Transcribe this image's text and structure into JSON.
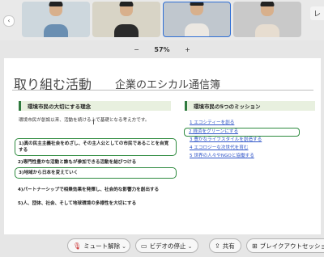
{
  "video_strip": {
    "more_label": "レ",
    "participants": [
      {
        "shirt": "#6a8fb2",
        "bg": "#cdd7dd"
      },
      {
        "shirt": "#2b2b2b",
        "bg": "#d8d4c6"
      },
      {
        "shirt": "#ece8e2",
        "bg": "#c0c7ce"
      },
      {
        "shirt": "#e7ddd0",
        "bg": "#c9c9c9"
      }
    ]
  },
  "zoom": {
    "minus": "−",
    "level": "57%",
    "plus": "+"
  },
  "slide": {
    "title": "取り組む活動",
    "subtitle": "企業のエシカル通信簿",
    "left_heading": "環境市民の大切にする理念",
    "intro": "環境市民が創設以来、活動を続ける上で基礎となる考え方です。",
    "points": [
      {
        "text": "1)真の民主主義社会をめざし、その主人公としての市民であることを自覚する",
        "highlight": true
      },
      {
        "text": "2)専門性豊かな活動と誰もが参加できる活動を結びつける",
        "highlight": false
      },
      {
        "text": "3)地域から日本を変えていく",
        "highlight": true
      },
      {
        "text": "4)パートナーシップで相乗効果を発揮し、社会的な影響力を創出する",
        "highlight": false
      },
      {
        "text": "5)人、団体、社会、そして地球環境の多様性を大切にする",
        "highlight": false
      }
    ],
    "right_heading": "環境市民の5つのミッション",
    "missions": [
      {
        "text": "1 エコシティーを創る",
        "highlight": false
      },
      {
        "text": "2 経済をグリーンにする",
        "highlight": true
      },
      {
        "text": "3 豊かなライフスタイルを創造する",
        "highlight": false
      },
      {
        "text": "4 エコロジーな次世代を育む",
        "highlight": false
      },
      {
        "text": "5 世界の人々やNGOと協働する",
        "highlight": false
      }
    ]
  },
  "toolbar": {
    "mute": "ミュート解除",
    "video": "ビデオの停止",
    "share": "共有",
    "breakout": "ブレイクアウトセッション"
  }
}
